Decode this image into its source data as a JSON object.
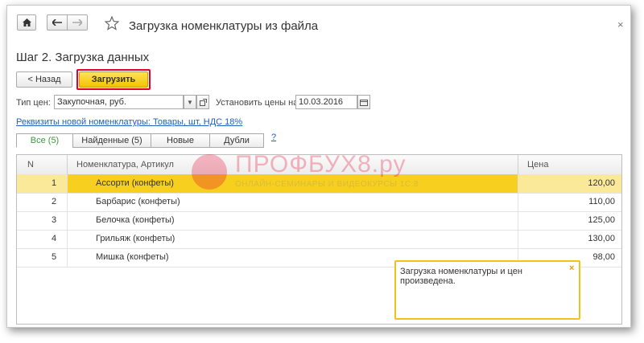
{
  "window": {
    "title": "Загрузка номенклатуры из файла",
    "close_glyph": "×"
  },
  "toolbar": {
    "home_icon": "home-icon",
    "back_icon": "arrow-left-icon",
    "forward_icon": "arrow-right-icon",
    "favorite_icon": "star-icon"
  },
  "step_title": "Шаг 2. Загрузка данных",
  "buttons": {
    "back_label": "< Назад",
    "load_label": "Загрузить"
  },
  "price_type": {
    "label": "Тип цен:",
    "value": "Закупочная, руб."
  },
  "set_prices": {
    "label": "Установить цены на:",
    "value": "10.03.2016"
  },
  "requisites_link": "Реквизиты новой номенклатуры: Товары, шт, НДС 18%",
  "tabs": [
    {
      "label": "Все (5)",
      "active": true
    },
    {
      "label": "Найденные (5)",
      "active": false
    },
    {
      "label": "Новые",
      "active": false
    },
    {
      "label": "Дубли",
      "active": false
    }
  ],
  "help_label": "?",
  "table": {
    "columns": [
      "N",
      "Номенклатура, Артикул",
      "Цена"
    ],
    "rows": [
      {
        "n": "1",
        "name": "Ассорти (конфеты)",
        "price": "120,00",
        "selected": true
      },
      {
        "n": "2",
        "name": "Барбарис (конфеты)",
        "price": "110,00",
        "selected": false
      },
      {
        "n": "3",
        "name": "Белочка (конфеты)",
        "price": "125,00",
        "selected": false
      },
      {
        "n": "4",
        "name": "Грильяж (конфеты)",
        "price": "130,00",
        "selected": false
      },
      {
        "n": "5",
        "name": "Мишка (конфеты)",
        "price": "98,00",
        "selected": false
      }
    ]
  },
  "notification": {
    "text": "Загрузка номенклатуры и цен произведена.",
    "close_glyph": "×"
  },
  "watermark": {
    "title": "ПРОФБУХ8.ру",
    "subtitle": "ОНЛАЙН-СЕМИНАРЫ И ВИДЕОКУРСЫ 1С:8"
  },
  "colors": {
    "accent_yellow": "#f4c400",
    "selection": "#f7cf1f",
    "link": "#1f5fbf",
    "highlight_red": "#e4002b",
    "active_tab_text": "#3a9a3a"
  }
}
